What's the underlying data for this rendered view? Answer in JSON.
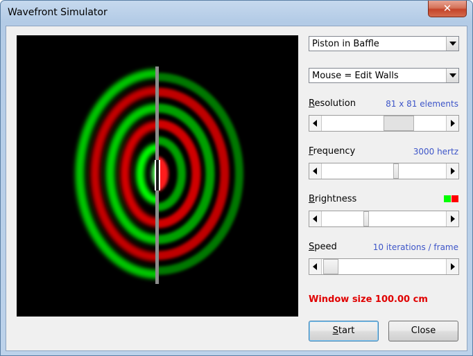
{
  "window": {
    "title": "Wavefront Simulator"
  },
  "controls": {
    "setup_combo": "Piston in Baffle",
    "mouse_combo": "Mouse = Edit Walls",
    "resolution": {
      "label_key": "R",
      "label_rest": "esolution",
      "value": "81 x 81 elements",
      "level": 0.6
    },
    "frequency": {
      "label_key": "F",
      "label_rest": "requency",
      "value": "3000 hertz",
      "level": 0.64
    },
    "brightness": {
      "label_key": "B",
      "label_rest": "rightness",
      "level": 0.39
    },
    "speed": {
      "label_key": "S",
      "label_rest": "peed",
      "value": "10 iterations / frame",
      "level": 0.08
    },
    "status": "Window size 100.00 cm",
    "start_key": "S",
    "start_rest": "tart",
    "close_label": "Close"
  },
  "colors": {
    "positive": "#00ff00",
    "negative": "#ff0000",
    "wall": "#8c8c8c",
    "piston": "#ffffff",
    "status": "#e00000",
    "accent_value": "#3d55c8"
  }
}
